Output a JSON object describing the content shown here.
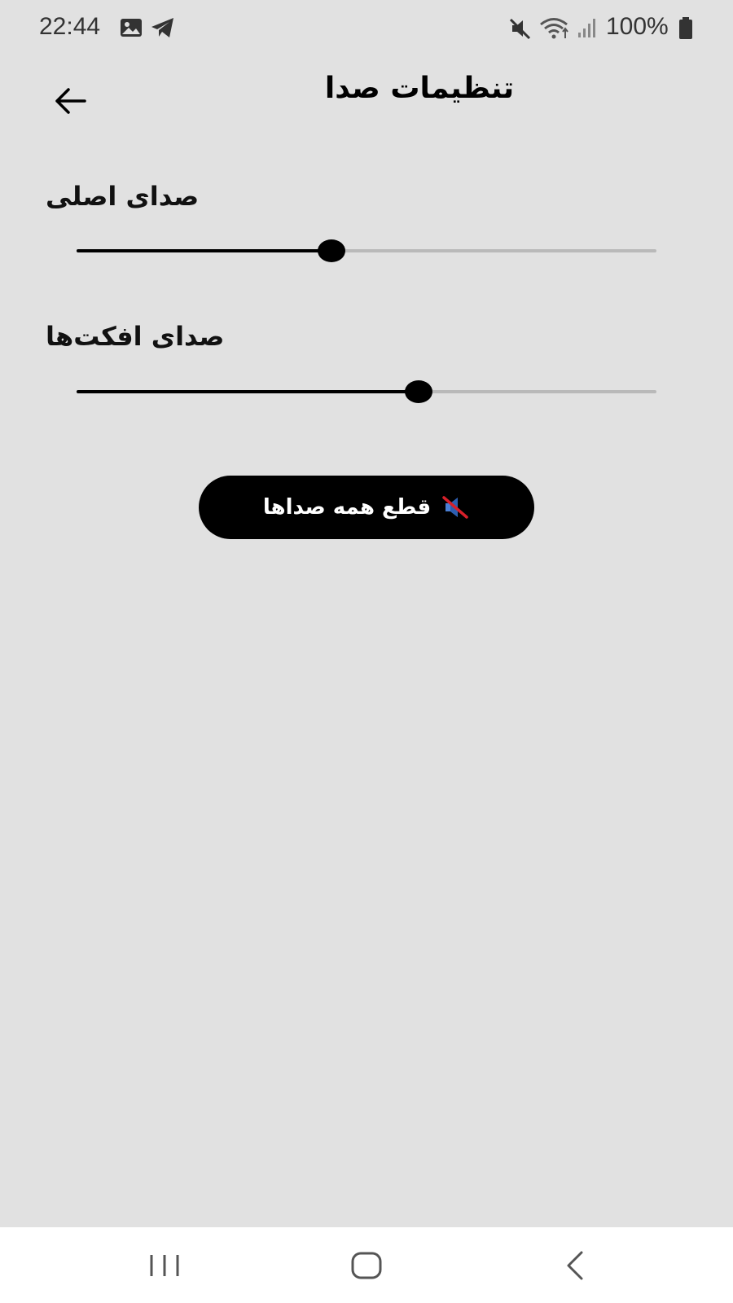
{
  "status_bar": {
    "time": "22:44",
    "battery": "100%",
    "icons": [
      "gallery-icon",
      "telegram-icon",
      "mute-icon",
      "wifi-icon",
      "signal-icon",
      "battery-icon"
    ]
  },
  "header": {
    "title": "تنظیمات صدا",
    "back_icon": "arrow-left-icon"
  },
  "sliders": [
    {
      "label": "صدای اصلی",
      "value": 0.44
    },
    {
      "label": "صدای افکت‌ها",
      "value": 0.59
    }
  ],
  "mute_button": {
    "label": "قطع همه صداها",
    "icon": "speaker-muted-icon"
  },
  "nav_bar": {
    "items": [
      "recent-apps-icon",
      "home-icon",
      "back-icon"
    ]
  },
  "colors": {
    "background": "#e1e1e1",
    "slider_active": "#000000",
    "slider_inactive": "#b9b9b9",
    "button_bg": "#000000",
    "button_text": "#ffffff"
  }
}
